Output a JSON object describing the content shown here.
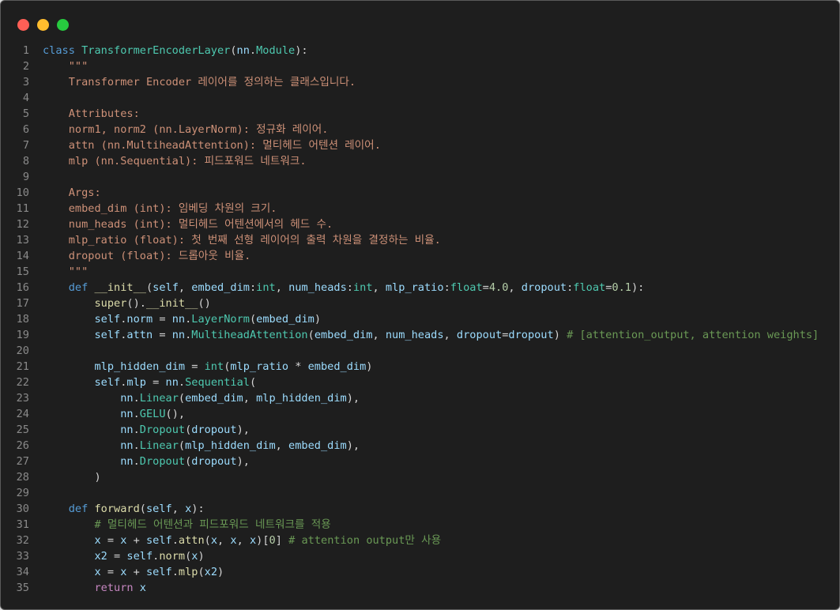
{
  "window": {
    "controls": [
      "close",
      "minimize",
      "maximize"
    ],
    "colors": {
      "close": "#ff5f56",
      "minimize": "#ffbd2e",
      "maximize": "#27c93f"
    }
  },
  "code": {
    "language": "python",
    "lines": [
      {
        "n": "1",
        "tokens": [
          [
            "k",
            "class"
          ],
          [
            "p",
            " "
          ],
          [
            "c",
            "TransformerEncoderLayer"
          ],
          [
            "p",
            "("
          ],
          [
            "v",
            "nn"
          ],
          [
            "p",
            "."
          ],
          [
            "c",
            "Module"
          ],
          [
            "p",
            "):"
          ]
        ]
      },
      {
        "n": "2",
        "tokens": [
          [
            "s",
            "    \"\"\""
          ]
        ]
      },
      {
        "n": "3",
        "tokens": [
          [
            "s",
            "    Transformer Encoder 레이어를 정의하는 클래스입니다."
          ]
        ]
      },
      {
        "n": "4",
        "tokens": [
          [
            "s",
            ""
          ]
        ]
      },
      {
        "n": "5",
        "tokens": [
          [
            "s",
            "    Attributes:"
          ]
        ]
      },
      {
        "n": "6",
        "tokens": [
          [
            "s",
            "    norm1, norm2 (nn.LayerNorm): 정규화 레이어."
          ]
        ]
      },
      {
        "n": "7",
        "tokens": [
          [
            "s",
            "    attn (nn.MultiheadAttention): 멀티헤드 어텐션 레이어."
          ]
        ]
      },
      {
        "n": "8",
        "tokens": [
          [
            "s",
            "    mlp (nn.Sequential): 피드포워드 네트워크."
          ]
        ]
      },
      {
        "n": "9",
        "tokens": [
          [
            "s",
            ""
          ]
        ]
      },
      {
        "n": "10",
        "tokens": [
          [
            "s",
            "    Args:"
          ]
        ]
      },
      {
        "n": "11",
        "tokens": [
          [
            "s",
            "    embed_dim (int): 임베딩 차원의 크기."
          ]
        ]
      },
      {
        "n": "12",
        "tokens": [
          [
            "s",
            "    num_heads (int): 멀티헤드 어텐션에서의 헤드 수."
          ]
        ]
      },
      {
        "n": "13",
        "tokens": [
          [
            "s",
            "    mlp_ratio (float): 첫 번째 선형 레이어의 출력 차원을 결정하는 비율."
          ]
        ]
      },
      {
        "n": "14",
        "tokens": [
          [
            "s",
            "    dropout (float): 드롭아웃 비율."
          ]
        ]
      },
      {
        "n": "15",
        "tokens": [
          [
            "s",
            "    \"\"\""
          ]
        ]
      },
      {
        "n": "16",
        "tokens": [
          [
            "p",
            "    "
          ],
          [
            "k",
            "def"
          ],
          [
            "p",
            " "
          ],
          [
            "f",
            "__init__"
          ],
          [
            "p",
            "("
          ],
          [
            "v",
            "self"
          ],
          [
            "p",
            ", "
          ],
          [
            "v",
            "embed_dim"
          ],
          [
            "p",
            ":"
          ],
          [
            "c",
            "int"
          ],
          [
            "p",
            ", "
          ],
          [
            "v",
            "num_heads"
          ],
          [
            "p",
            ":"
          ],
          [
            "c",
            "int"
          ],
          [
            "p",
            ", "
          ],
          [
            "v",
            "mlp_ratio"
          ],
          [
            "p",
            ":"
          ],
          [
            "c",
            "float"
          ],
          [
            "p",
            "="
          ],
          [
            "n",
            "4.0"
          ],
          [
            "p",
            ", "
          ],
          [
            "v",
            "dropout"
          ],
          [
            "p",
            ":"
          ],
          [
            "c",
            "float"
          ],
          [
            "p",
            "="
          ],
          [
            "n",
            "0.1"
          ],
          [
            "p",
            "):"
          ]
        ]
      },
      {
        "n": "17",
        "tokens": [
          [
            "p",
            "        "
          ],
          [
            "f",
            "super"
          ],
          [
            "p",
            "()."
          ],
          [
            "f",
            "__init__"
          ],
          [
            "p",
            "()"
          ]
        ]
      },
      {
        "n": "18",
        "tokens": [
          [
            "p",
            "        "
          ],
          [
            "v",
            "self"
          ],
          [
            "p",
            "."
          ],
          [
            "v",
            "norm"
          ],
          [
            "p",
            " = "
          ],
          [
            "v",
            "nn"
          ],
          [
            "p",
            "."
          ],
          [
            "c",
            "LayerNorm"
          ],
          [
            "p",
            "("
          ],
          [
            "v",
            "embed_dim"
          ],
          [
            "p",
            ")"
          ]
        ]
      },
      {
        "n": "19",
        "tokens": [
          [
            "p",
            "        "
          ],
          [
            "v",
            "self"
          ],
          [
            "p",
            "."
          ],
          [
            "v",
            "attn"
          ],
          [
            "p",
            " = "
          ],
          [
            "v",
            "nn"
          ],
          [
            "p",
            "."
          ],
          [
            "c",
            "MultiheadAttention"
          ],
          [
            "p",
            "("
          ],
          [
            "v",
            "embed_dim"
          ],
          [
            "p",
            ", "
          ],
          [
            "v",
            "num_heads"
          ],
          [
            "p",
            ", "
          ],
          [
            "v",
            "dropout"
          ],
          [
            "p",
            "="
          ],
          [
            "v",
            "dropout"
          ],
          [
            "p",
            ") "
          ],
          [
            "cm",
            "# [attention_output, attention weights]"
          ]
        ]
      },
      {
        "n": "20",
        "tokens": [
          [
            "p",
            ""
          ]
        ]
      },
      {
        "n": "21",
        "tokens": [
          [
            "p",
            "        "
          ],
          [
            "v",
            "mlp_hidden_dim"
          ],
          [
            "p",
            " = "
          ],
          [
            "c",
            "int"
          ],
          [
            "p",
            "("
          ],
          [
            "v",
            "mlp_ratio"
          ],
          [
            "p",
            " * "
          ],
          [
            "v",
            "embed_dim"
          ],
          [
            "p",
            ")"
          ]
        ]
      },
      {
        "n": "22",
        "tokens": [
          [
            "p",
            "        "
          ],
          [
            "v",
            "self"
          ],
          [
            "p",
            "."
          ],
          [
            "v",
            "mlp"
          ],
          [
            "p",
            " = "
          ],
          [
            "v",
            "nn"
          ],
          [
            "p",
            "."
          ],
          [
            "c",
            "Sequential"
          ],
          [
            "p",
            "("
          ]
        ]
      },
      {
        "n": "23",
        "tokens": [
          [
            "p",
            "            "
          ],
          [
            "v",
            "nn"
          ],
          [
            "p",
            "."
          ],
          [
            "c",
            "Linear"
          ],
          [
            "p",
            "("
          ],
          [
            "v",
            "embed_dim"
          ],
          [
            "p",
            ", "
          ],
          [
            "v",
            "mlp_hidden_dim"
          ],
          [
            "p",
            "),"
          ]
        ]
      },
      {
        "n": "24",
        "tokens": [
          [
            "p",
            "            "
          ],
          [
            "v",
            "nn"
          ],
          [
            "p",
            "."
          ],
          [
            "c",
            "GELU"
          ],
          [
            "p",
            "(),"
          ]
        ]
      },
      {
        "n": "25",
        "tokens": [
          [
            "p",
            "            "
          ],
          [
            "v",
            "nn"
          ],
          [
            "p",
            "."
          ],
          [
            "c",
            "Dropout"
          ],
          [
            "p",
            "("
          ],
          [
            "v",
            "dropout"
          ],
          [
            "p",
            "),"
          ]
        ]
      },
      {
        "n": "26",
        "tokens": [
          [
            "p",
            "            "
          ],
          [
            "v",
            "nn"
          ],
          [
            "p",
            "."
          ],
          [
            "c",
            "Linear"
          ],
          [
            "p",
            "("
          ],
          [
            "v",
            "mlp_hidden_dim"
          ],
          [
            "p",
            ", "
          ],
          [
            "v",
            "embed_dim"
          ],
          [
            "p",
            "),"
          ]
        ]
      },
      {
        "n": "27",
        "tokens": [
          [
            "p",
            "            "
          ],
          [
            "v",
            "nn"
          ],
          [
            "p",
            "."
          ],
          [
            "c",
            "Dropout"
          ],
          [
            "p",
            "("
          ],
          [
            "v",
            "dropout"
          ],
          [
            "p",
            "),"
          ]
        ]
      },
      {
        "n": "28",
        "tokens": [
          [
            "p",
            "        )"
          ]
        ]
      },
      {
        "n": "29",
        "tokens": [
          [
            "p",
            ""
          ]
        ]
      },
      {
        "n": "30",
        "tokens": [
          [
            "p",
            "    "
          ],
          [
            "k",
            "def"
          ],
          [
            "p",
            " "
          ],
          [
            "f",
            "forward"
          ],
          [
            "p",
            "("
          ],
          [
            "v",
            "self"
          ],
          [
            "p",
            ", "
          ],
          [
            "v",
            "x"
          ],
          [
            "p",
            "):"
          ]
        ]
      },
      {
        "n": "31",
        "tokens": [
          [
            "p",
            "        "
          ],
          [
            "cm",
            "# 멀티헤드 어텐션과 피드포워드 네트워크를 적용"
          ]
        ]
      },
      {
        "n": "32",
        "tokens": [
          [
            "p",
            "        "
          ],
          [
            "v",
            "x"
          ],
          [
            "p",
            " = "
          ],
          [
            "v",
            "x"
          ],
          [
            "p",
            " + "
          ],
          [
            "v",
            "self"
          ],
          [
            "p",
            "."
          ],
          [
            "f",
            "attn"
          ],
          [
            "p",
            "("
          ],
          [
            "v",
            "x"
          ],
          [
            "p",
            ", "
          ],
          [
            "v",
            "x"
          ],
          [
            "p",
            ", "
          ],
          [
            "v",
            "x"
          ],
          [
            "p",
            ")["
          ],
          [
            "n",
            "0"
          ],
          [
            "p",
            "] "
          ],
          [
            "cm",
            "# attention output만 사용"
          ]
        ]
      },
      {
        "n": "33",
        "tokens": [
          [
            "p",
            "        "
          ],
          [
            "v",
            "x2"
          ],
          [
            "p",
            " = "
          ],
          [
            "v",
            "self"
          ],
          [
            "p",
            "."
          ],
          [
            "f",
            "norm"
          ],
          [
            "p",
            "("
          ],
          [
            "v",
            "x"
          ],
          [
            "p",
            ")"
          ]
        ]
      },
      {
        "n": "34",
        "tokens": [
          [
            "p",
            "        "
          ],
          [
            "v",
            "x"
          ],
          [
            "p",
            " = "
          ],
          [
            "v",
            "x"
          ],
          [
            "p",
            " + "
          ],
          [
            "v",
            "self"
          ],
          [
            "p",
            "."
          ],
          [
            "f",
            "mlp"
          ],
          [
            "p",
            "("
          ],
          [
            "v",
            "x2"
          ],
          [
            "p",
            ")"
          ]
        ]
      },
      {
        "n": "35",
        "tokens": [
          [
            "p",
            "        "
          ],
          [
            "kc",
            "return"
          ],
          [
            "p",
            " "
          ],
          [
            "v",
            "x"
          ]
        ]
      }
    ]
  }
}
